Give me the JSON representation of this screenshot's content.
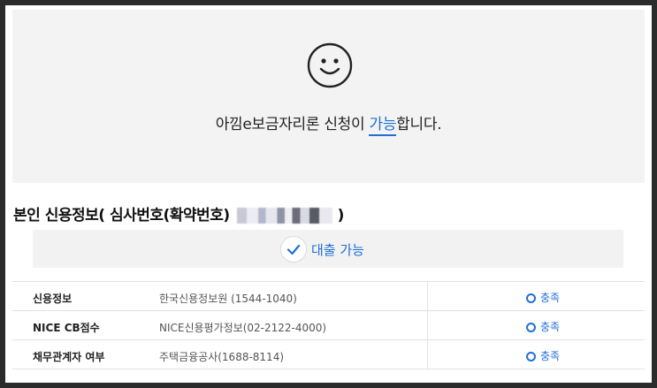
{
  "hero": {
    "icon": "smiley-icon",
    "message_pre": "아낌e보금자리론 신청이 ",
    "message_highlight": "가능",
    "message_post": "합니다."
  },
  "section": {
    "title_pre": "본인 신용정보( 심사번호(확약번호)",
    "title_post": ")"
  },
  "status": {
    "icon": "check-icon",
    "label": "대출 가능"
  },
  "rows": [
    {
      "label": "신용정보",
      "agency": "한국신용정보원 (1544-1040)",
      "result": "충족"
    },
    {
      "label": "NICE CB점수",
      "agency": "NICE신용평가정보(02-2122-4000)",
      "result": "충족"
    },
    {
      "label": "채무관계자 여부",
      "agency": "주택금융공사(1688-8114)",
      "result": "충족"
    }
  ],
  "colors": {
    "accent": "#1f6fd6",
    "panel": "#f3f3f3"
  }
}
